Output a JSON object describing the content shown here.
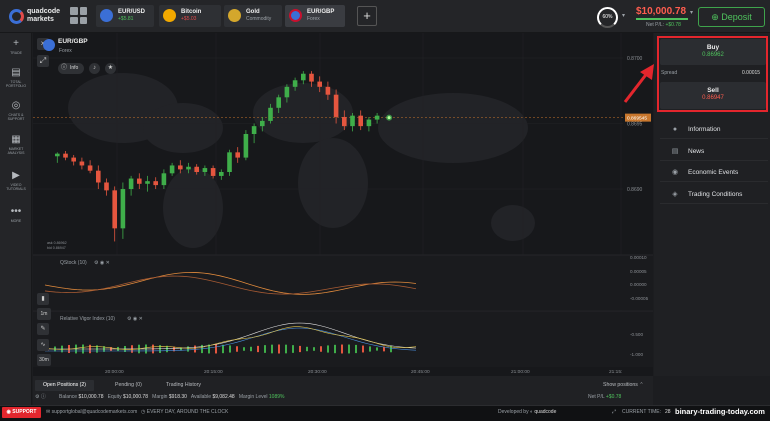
{
  "app": {
    "logo_line1": "quadcode",
    "logo_line2": "markets"
  },
  "tabs": [
    {
      "name": "EUR/USD",
      "sub": "+$5.81",
      "sub_color": "pos"
    },
    {
      "name": "Bitcoin",
      "sub": "+$5.03",
      "sub_color": "neg"
    },
    {
      "name": "Gold",
      "sub": "Commodity",
      "sub_color": "none"
    },
    {
      "name": "EUR/GBP",
      "sub": "Forex",
      "sub_color": "none"
    }
  ],
  "header": {
    "gauge": "60%",
    "balance": "$10,000.78",
    "net_pl_label": "Net P/L",
    "net_pl_value": "+$0.78",
    "deposit_label": "Deposit"
  },
  "leftbar": [
    {
      "label": "TRADE",
      "icon": "plus-icon"
    },
    {
      "label": "TOTAL PORTFOLIO",
      "icon": "portfolio-icon"
    },
    {
      "label": "CHATS & SUPPORT",
      "icon": "chat-icon"
    },
    {
      "label": "MARKET ANALYSIS",
      "icon": "analysis-icon"
    },
    {
      "label": "VIDEO TUTORIALS",
      "icon": "play-icon"
    },
    {
      "label": "MORE",
      "icon": "more-icon"
    }
  ],
  "chart_header": {
    "pair": "EUR/GBP",
    "category": "Forex",
    "info_label": "Info"
  },
  "chart_data": {
    "type": "candlestick",
    "price_ticks": [
      "0.8700",
      "0.8695",
      "0.8690"
    ],
    "current_price": "0.869545",
    "ask_label": "ask 0.86962",
    "bid_label": "bid 0.86947",
    "time_ticks": [
      "20:00:00",
      "20:15:00",
      "20:30:00",
      "20:45:00",
      "21:00:00",
      "21:15:"
    ],
    "timeframe": "1m",
    "zoom": "30m",
    "candles": [
      [
        0.86925,
        0.86928,
        0.8692,
        0.86927,
        "up"
      ],
      [
        0.86927,
        0.86929,
        0.86922,
        0.86924,
        "down"
      ],
      [
        0.86924,
        0.86926,
        0.86918,
        0.86921,
        "down"
      ],
      [
        0.86921,
        0.86924,
        0.86915,
        0.86918,
        "down"
      ],
      [
        0.86918,
        0.86922,
        0.86912,
        0.86914,
        "down"
      ],
      [
        0.86914,
        0.86918,
        0.869,
        0.86905,
        "down"
      ],
      [
        0.86905,
        0.86908,
        0.86895,
        0.86899,
        "down"
      ],
      [
        0.86899,
        0.86902,
        0.8686,
        0.8687,
        "down"
      ],
      [
        0.8687,
        0.86905,
        0.86862,
        0.869,
        "up"
      ],
      [
        0.869,
        0.8691,
        0.86895,
        0.86908,
        "up"
      ],
      [
        0.86908,
        0.86912,
        0.869,
        0.86904,
        "down"
      ],
      [
        0.86904,
        0.8691,
        0.86898,
        0.86906,
        "up"
      ],
      [
        0.86906,
        0.86909,
        0.869,
        0.86903,
        "down"
      ],
      [
        0.86903,
        0.86915,
        0.869,
        0.86912,
        "up"
      ],
      [
        0.86912,
        0.8692,
        0.8691,
        0.86918,
        "up"
      ],
      [
        0.86918,
        0.86922,
        0.86912,
        0.86915,
        "down"
      ],
      [
        0.86915,
        0.8692,
        0.86912,
        0.86917,
        "up"
      ],
      [
        0.86917,
        0.86919,
        0.86911,
        0.86913,
        "down"
      ],
      [
        0.86913,
        0.86918,
        0.8691,
        0.86916,
        "up"
      ],
      [
        0.86916,
        0.86918,
        0.86908,
        0.8691,
        "down"
      ],
      [
        0.8691,
        0.86915,
        0.86907,
        0.86913,
        "up"
      ],
      [
        0.86913,
        0.8693,
        0.8691,
        0.86928,
        "up"
      ],
      [
        0.86928,
        0.86932,
        0.8692,
        0.86924,
        "down"
      ],
      [
        0.86924,
        0.86945,
        0.86922,
        0.86942,
        "up"
      ],
      [
        0.86942,
        0.8695,
        0.86935,
        0.86948,
        "up"
      ],
      [
        0.86948,
        0.86955,
        0.86944,
        0.86952,
        "up"
      ],
      [
        0.86952,
        0.86965,
        0.8695,
        0.86962,
        "up"
      ],
      [
        0.86962,
        0.86972,
        0.86958,
        0.8697,
        "up"
      ],
      [
        0.8697,
        0.8698,
        0.86966,
        0.86978,
        "up"
      ],
      [
        0.86978,
        0.86985,
        0.86975,
        0.86983,
        "up"
      ],
      [
        0.86983,
        0.8699,
        0.8698,
        0.86988,
        "up"
      ],
      [
        0.86988,
        0.8699,
        0.86978,
        0.86982,
        "down"
      ],
      [
        0.86982,
        0.86986,
        0.86974,
        0.86978,
        "down"
      ],
      [
        0.86978,
        0.86982,
        0.86968,
        0.86972,
        "down"
      ],
      [
        0.86972,
        0.86976,
        0.8695,
        0.86955,
        "down"
      ],
      [
        0.86955,
        0.8696,
        0.86945,
        0.86948,
        "down"
      ],
      [
        0.86948,
        0.86958,
        0.86944,
        0.86956,
        "up"
      ],
      [
        0.86956,
        0.8696,
        0.86945,
        0.86948,
        "down"
      ],
      [
        0.86948,
        0.86955,
        0.86944,
        0.86953,
        "up"
      ],
      [
        0.86953,
        0.86958,
        0.8695,
        0.86956,
        "up"
      ]
    ]
  },
  "indicators": [
    {
      "name": "QStock (10)",
      "ticks": [
        "0.00010",
        "0.00005",
        "0.00000",
        "-0.00005"
      ]
    },
    {
      "name": "Relative Vigor Index (10)",
      "ticks": [
        "-0.500",
        "-1.000"
      ]
    }
  ],
  "trade_panel": {
    "buy_label": "Buy",
    "buy_price": "0.86962",
    "spread_label": "Spread",
    "spread_value": "0.00015",
    "sell_label": "Sell",
    "sell_price": "0.86947"
  },
  "side_menu": [
    {
      "label": "Information",
      "icon": "info-icon"
    },
    {
      "label": "News",
      "icon": "news-icon"
    },
    {
      "label": "Economic Events",
      "icon": "events-icon"
    },
    {
      "label": "Trading Conditions",
      "icon": "conditions-icon"
    }
  ],
  "bottom": {
    "tabs": [
      "Open Positions (2)",
      "Pending (0)",
      "Trading History"
    ],
    "show_positions": "Show positions",
    "balance_label": "Balance",
    "balance": "$10,000.78",
    "equity_label": "Equity",
    "equity": "$10,000.78",
    "margin_label": "Margin",
    "margin": "$918.30",
    "available_label": "Available",
    "available": "$9,082.48",
    "margin_level_label": "Margin Level",
    "margin_level": "1089%",
    "net_pl_label": "Net P/L",
    "net_pl": "+$0.78"
  },
  "footer": {
    "support": "SUPPORT",
    "email": "supportglobal@quadcodemarkets.com",
    "tagline": "EVERY DAY, AROUND THE CLOCK",
    "developed_by": "Developed by",
    "dev_brand": "quadcode",
    "current_time_label": "CURRENT TIME:",
    "current_time": "28",
    "watermark": "binary-trading-today.com"
  }
}
